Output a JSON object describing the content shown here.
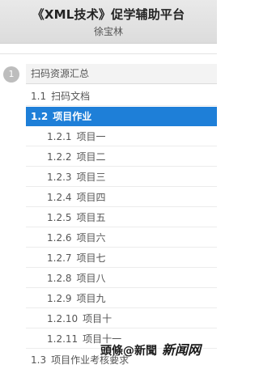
{
  "header": {
    "title": "《XML技术》促学辅助平台",
    "author": "徐宝林"
  },
  "section": {
    "number": "1",
    "label": "扫码资源汇总"
  },
  "items": [
    {
      "num": "1.1",
      "label": "扫码文档"
    },
    {
      "num": "1.2",
      "label": "项目作业"
    },
    {
      "num": "1.2.1",
      "label": "项目一"
    },
    {
      "num": "1.2.2",
      "label": "项目二"
    },
    {
      "num": "1.2.3",
      "label": "项目三"
    },
    {
      "num": "1.2.4",
      "label": "项目四"
    },
    {
      "num": "1.2.5",
      "label": "项目五"
    },
    {
      "num": "1.2.6",
      "label": "项目六"
    },
    {
      "num": "1.2.7",
      "label": "项目七"
    },
    {
      "num": "1.2.8",
      "label": "项目八"
    },
    {
      "num": "1.2.9",
      "label": "项目九"
    },
    {
      "num": "1.2.10",
      "label": "项目十"
    },
    {
      "num": "1.2.11",
      "label": "项目十一"
    },
    {
      "num": "1.3",
      "label": "项目作业考核要求"
    }
  ],
  "watermark": {
    "text": "頭條@新聞",
    "logo": "新闻网"
  },
  "colors": {
    "active": "#1e7fd8",
    "header_bg": "#dcdcdc"
  }
}
